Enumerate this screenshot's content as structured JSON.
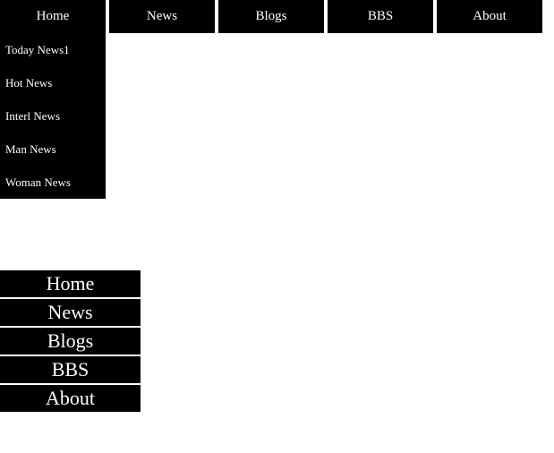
{
  "topnav": {
    "items": [
      {
        "label": "Home"
      },
      {
        "label": "News"
      },
      {
        "label": "Blogs"
      },
      {
        "label": "BBS"
      },
      {
        "label": "About"
      }
    ]
  },
  "submenu": {
    "items": [
      {
        "label": "Today News1"
      },
      {
        "label": "Hot News"
      },
      {
        "label": "Interl News"
      },
      {
        "label": "Man News"
      },
      {
        "label": "Woman News"
      }
    ]
  },
  "bottomnav": {
    "items": [
      {
        "label": "Home"
      },
      {
        "label": "News"
      },
      {
        "label": "Blogs"
      },
      {
        "label": "BBS"
      },
      {
        "label": "About"
      }
    ]
  }
}
